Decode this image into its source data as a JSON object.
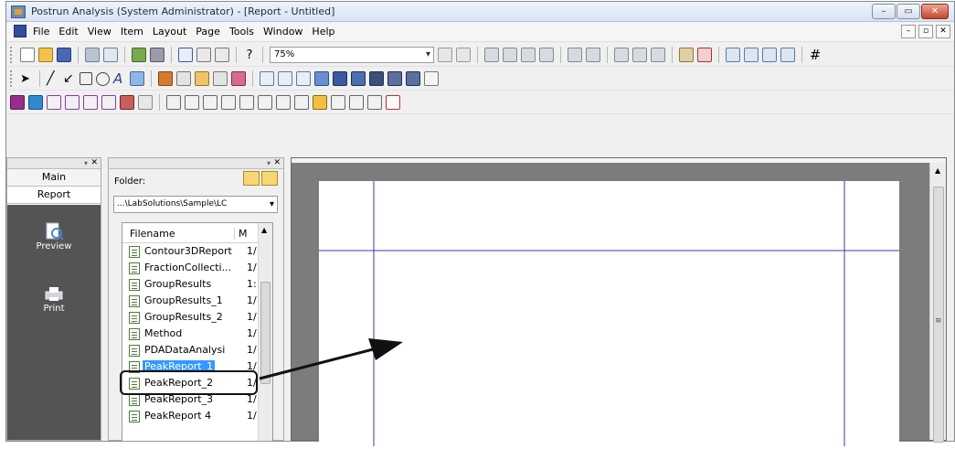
{
  "window": {
    "title": "Postrun Analysis (System Administrator) - [Report - Untitled]",
    "caption_buttons": {
      "minimize": "–",
      "restore": "▭",
      "close": "✕"
    }
  },
  "menubar": {
    "items": [
      "File",
      "Edit",
      "View",
      "Item",
      "Layout",
      "Page",
      "Tools",
      "Window",
      "Help"
    ],
    "mdi_buttons": {
      "minimize": "–",
      "restore": "▫",
      "close": "✕"
    }
  },
  "toolbar": {
    "zoom_value": "75%",
    "help_label": "?"
  },
  "main_panel": {
    "tabs": [
      "Main",
      "Report"
    ],
    "nav": [
      {
        "label": "Preview",
        "icon": "preview-icon"
      },
      {
        "label": "Print",
        "icon": "printer-icon"
      }
    ]
  },
  "folder_panel": {
    "folder_label": "Folder:",
    "folder_path": "...\\LabSolutions\\Sample\\LC",
    "columns": [
      "Filename",
      "M"
    ],
    "files": [
      {
        "name": "Contour3DReport",
        "date": "1/"
      },
      {
        "name": "FractionCollecti...",
        "date": "1/"
      },
      {
        "name": "GroupResults",
        "date": "1:"
      },
      {
        "name": "GroupResults_1",
        "date": "1/"
      },
      {
        "name": "GroupResults_2",
        "date": "1/"
      },
      {
        "name": "Method",
        "date": "1/"
      },
      {
        "name": "PDADataAnalysi",
        "date": "1/"
      },
      {
        "name": "PeakReport_1",
        "date": "1/",
        "selected": true
      },
      {
        "name": "PeakReport_2",
        "date": "1/"
      },
      {
        "name": "PeakReport_3",
        "date": "1/"
      },
      {
        "name": "PeakReport 4",
        "date": "1/"
      }
    ]
  },
  "colors": {
    "nav_bg": "#545454",
    "selection": "#3399ff",
    "guide_line": "#3b3b9c",
    "doc_bg": "#7c7c7c"
  }
}
